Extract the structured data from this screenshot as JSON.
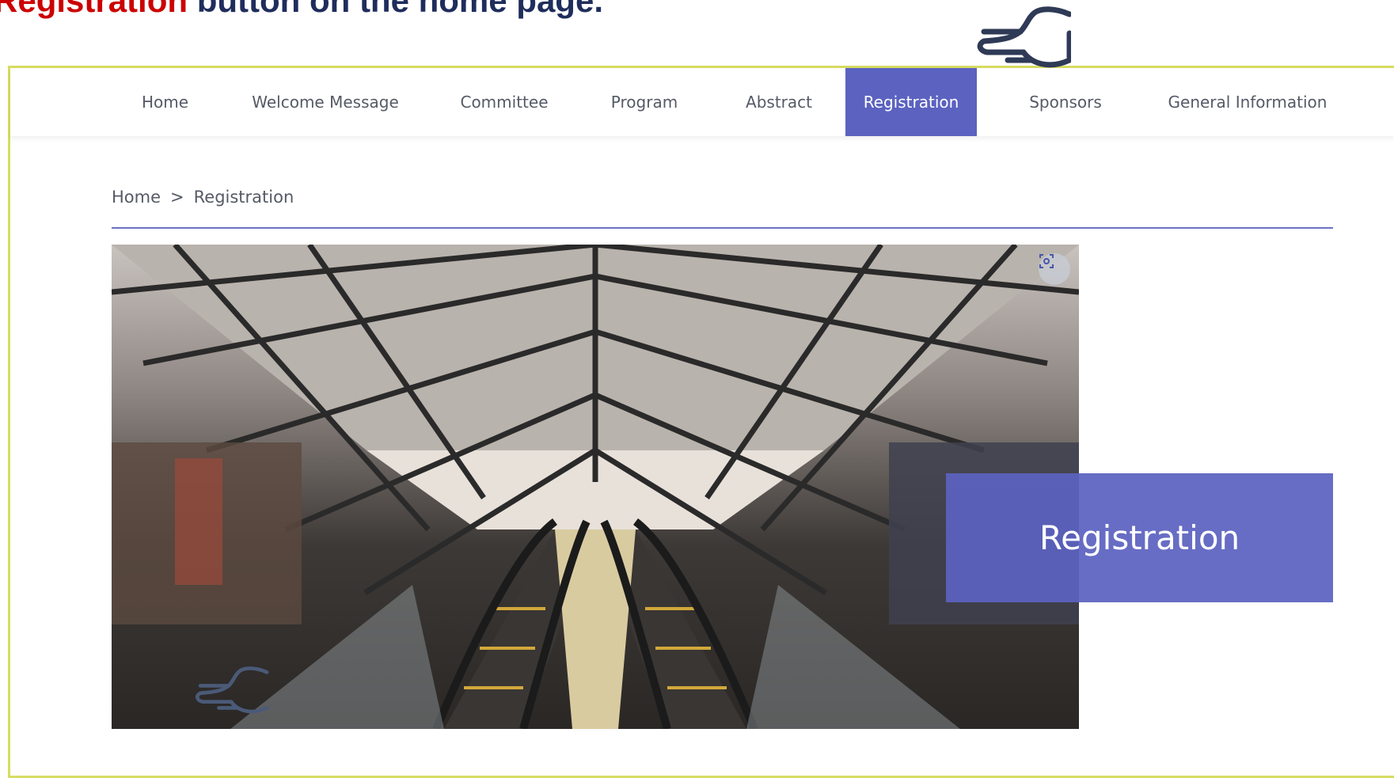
{
  "instruction": {
    "highlight": "Registration",
    "rest": " button on the home page."
  },
  "nav": {
    "items": [
      {
        "label": "Home"
      },
      {
        "label": "Welcome Message"
      },
      {
        "label": "Committee"
      },
      {
        "label": "Program"
      },
      {
        "label": "Abstract"
      },
      {
        "label": "Registration",
        "active": true
      },
      {
        "label": "Sponsors"
      },
      {
        "label": "General Information"
      }
    ]
  },
  "breadcrumb": {
    "home": "Home",
    "separator": ">",
    "current": "Registration"
  },
  "hero": {
    "overlay_title": "Registration",
    "scan_icon": "scan-icon"
  },
  "colors": {
    "accent": "#5b62c0",
    "frame": "#d7dc63",
    "instruction_highlight": "#cc0000",
    "instruction_text": "#1f2d5c"
  }
}
